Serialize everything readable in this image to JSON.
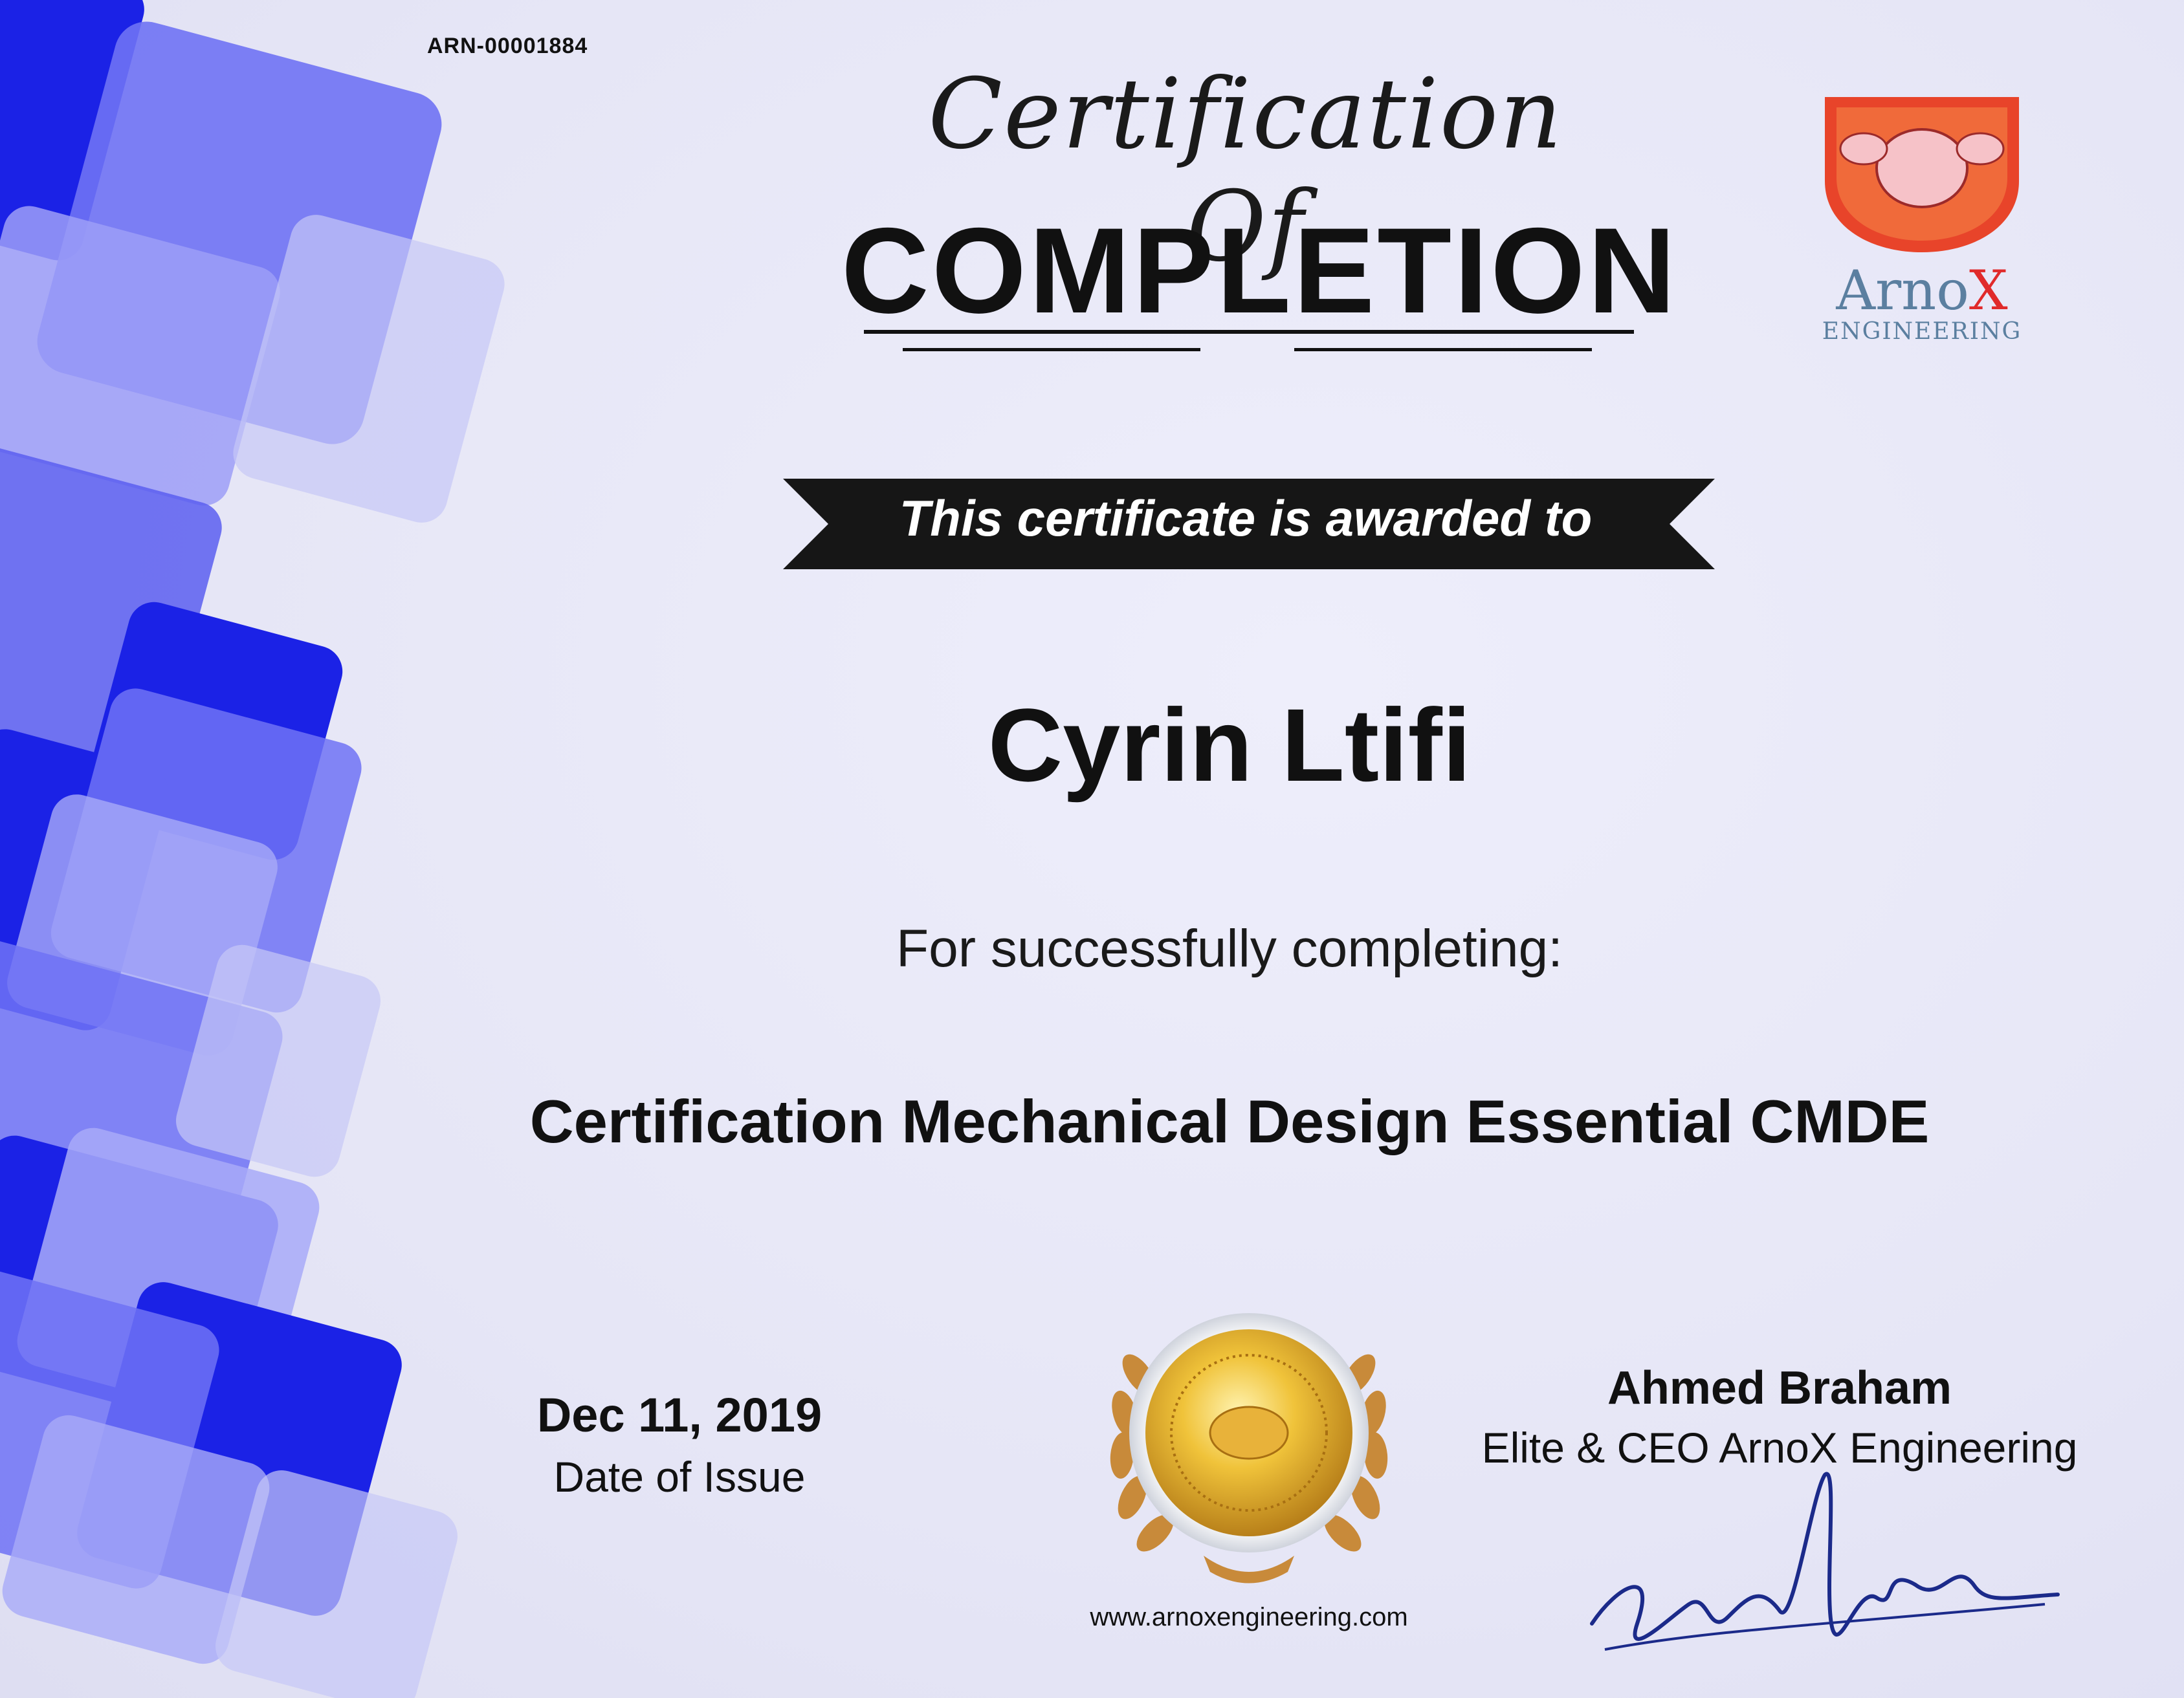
{
  "certificate": {
    "id": "ARN-00001884",
    "script_title": "Certification Of",
    "main_title": "COMPLETION",
    "ribbon_text": "This certificate is awarded to",
    "recipient": "Cyrin Ltifi",
    "for_text": "For successfully completing:",
    "course": "Certification Mechanical Design Essential CMDE"
  },
  "issue": {
    "date": "Dec 11, 2019",
    "label": "Date of Issue"
  },
  "seal": {
    "website": "www.arnoxengineering.com"
  },
  "signer": {
    "name": "Ahmed Braham",
    "title": "Elite & CEO ArnoX Engineering"
  },
  "brand": {
    "name_part1": "Arno",
    "name_part2": "X",
    "subtitle": "ENGINEERING",
    "colors": {
      "primary_blue": "#5b7fa0",
      "accent_red": "#e02a2a",
      "tile_blue": "#1f2fe8",
      "gold": "#d6a02a"
    }
  }
}
